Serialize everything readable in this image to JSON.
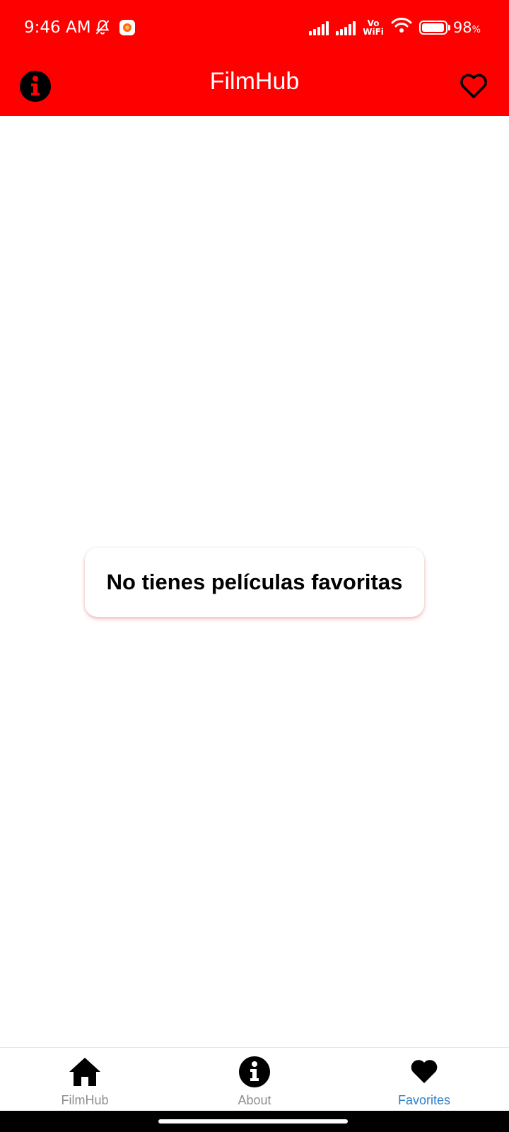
{
  "status_bar": {
    "time": "9:46 AM",
    "icons": [
      "bell-off-icon",
      "notification-app-icon"
    ],
    "network_icons": [
      "signal-icon",
      "signal-icon",
      "vowifi-icon",
      "wifi-icon"
    ],
    "vowifi_top": "Vo",
    "vowifi_bottom": "WiFi",
    "battery_level": 0.98,
    "battery_value": "98",
    "battery_unit": "%"
  },
  "app_bar": {
    "title": "FilmHub",
    "left_icon": "info-icon",
    "right_icon": "heart-outline-icon",
    "background": "#ff0000"
  },
  "main": {
    "empty_message": "No tienes películas favoritas"
  },
  "bottom_nav": {
    "items": [
      {
        "label": "FilmHub",
        "icon": "home-icon",
        "active": false
      },
      {
        "label": "About",
        "icon": "info-icon",
        "active": false
      },
      {
        "label": "Favorites",
        "icon": "heart-icon",
        "active": true
      }
    ],
    "active_color": "#2f80c8",
    "inactive_color": "#8e8e8e"
  }
}
